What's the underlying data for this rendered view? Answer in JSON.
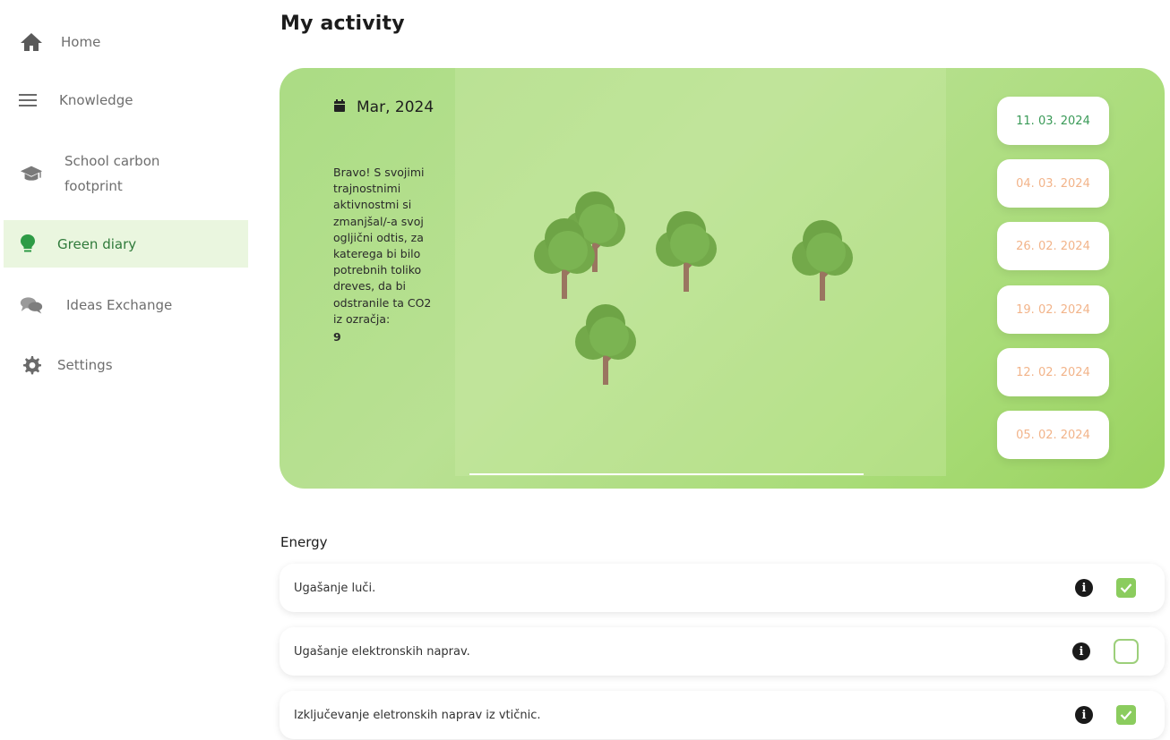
{
  "sidebar": {
    "items": [
      {
        "label": "Home",
        "icon": "home-icon"
      },
      {
        "label": "Knowledge",
        "icon": "menu-lines-icon"
      },
      {
        "label": "School carbon",
        "label2": "footprint",
        "icon": "graduation-cap-icon"
      },
      {
        "label": "Green diary",
        "icon": "lightbulb-icon",
        "active": true
      },
      {
        "label": "Ideas Exchange",
        "icon": "chat-bubbles-icon"
      },
      {
        "label": "Settings",
        "icon": "gear-icon"
      }
    ]
  },
  "page": {
    "title": "My activity"
  },
  "card": {
    "month": "Mar, 2024",
    "message_lines": [
      "Bravo! S svojimi",
      "trajnostnimi",
      "aktivnostmi si",
      "zmanjšal/-a svoj",
      "ogljični odtis, za",
      "katerega bi bilo",
      "potrebnih toliko",
      "dreves, da bi",
      "odstranile ta CO2",
      "iz ozračja:"
    ],
    "tree_count": "9",
    "dates": [
      {
        "label": "11. 03. 2024",
        "active": true
      },
      {
        "label": "04. 03. 2024",
        "active": false
      },
      {
        "label": "26. 02. 2024",
        "active": false
      },
      {
        "label": "19. 02. 2024",
        "active": false
      },
      {
        "label": "12. 02. 2024",
        "active": false
      },
      {
        "label": "05. 02. 2024",
        "active": false
      }
    ]
  },
  "energy": {
    "title": "Energy",
    "activities": [
      {
        "label": "Ugašanje luči.",
        "checked": true
      },
      {
        "label": "Ugašanje elektronskih naprav.",
        "checked": false
      },
      {
        "label": "Izključevanje eletronskih naprav iz vtičnic.",
        "checked": true
      }
    ]
  },
  "colors": {
    "accent_green": "#8bcc5e",
    "active_date": "#3a9a58",
    "inactive_date": "#f2b48a",
    "sidebar_active_bg": "#eaf6df"
  }
}
